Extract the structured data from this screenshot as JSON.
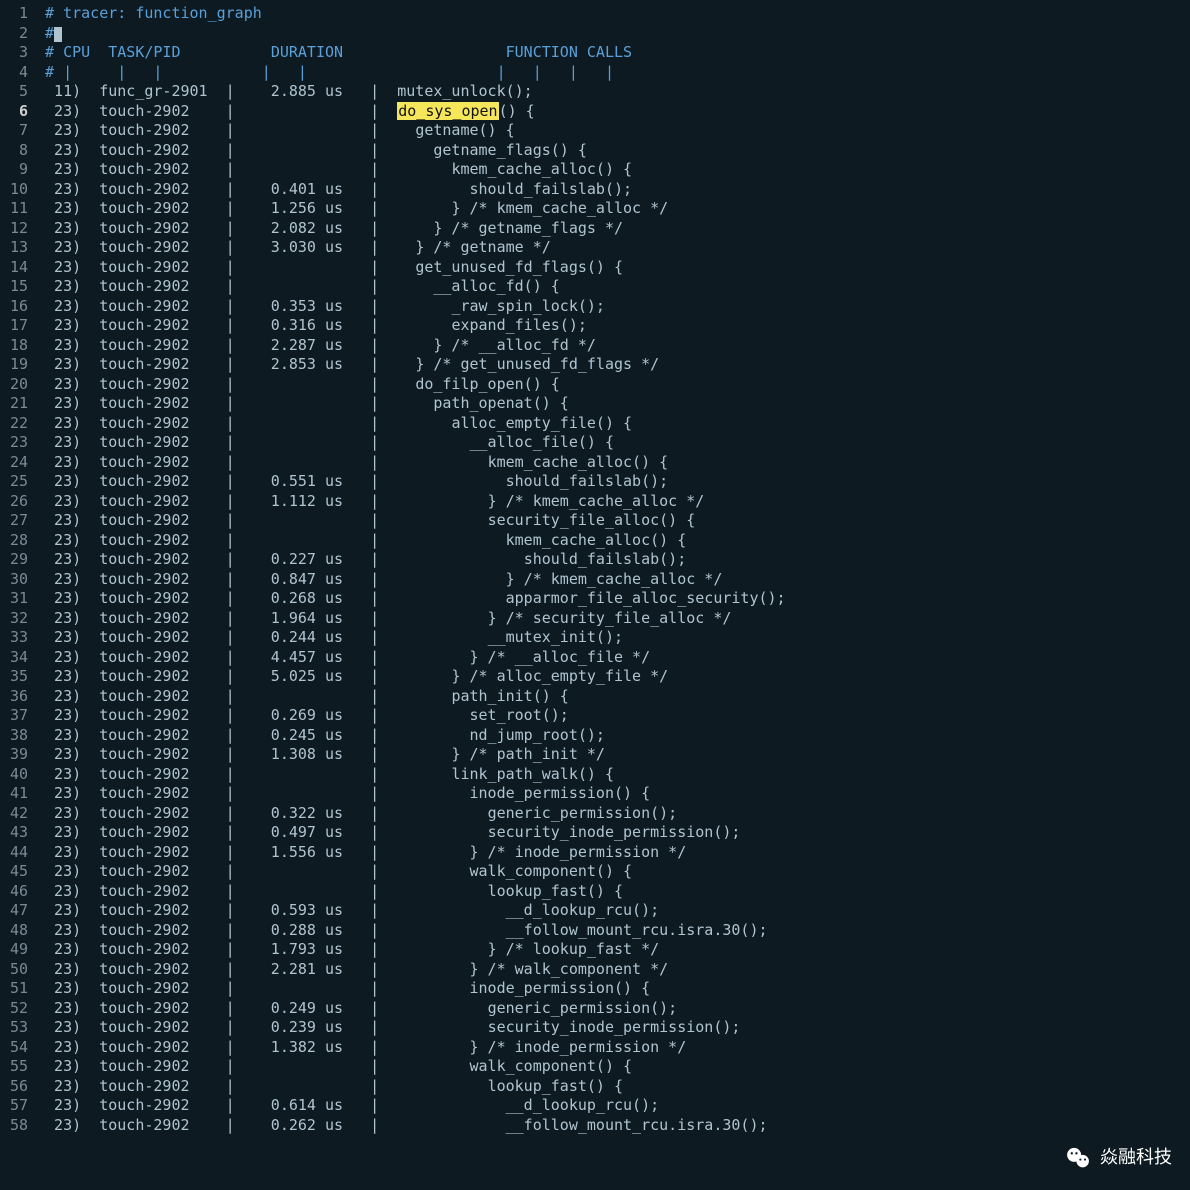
{
  "watermark": "焱融科技",
  "header": {
    "line1": "# tracer: function_graph",
    "cpu": "CPU",
    "task": "TASK/PID",
    "duration": "DURATION",
    "calls": "FUNCTION CALLS"
  },
  "rows": [
    {
      "n": 5,
      "cpu": "11)",
      "task": "func_gr-2901",
      "dur": "2.885 us",
      "indent": 0,
      "call": "mutex_unlock();"
    },
    {
      "n": 6,
      "cpu": "23)",
      "task": "touch-2902",
      "dur": "",
      "indent": 0,
      "call": "do_sys_open() {",
      "hl": true,
      "mark": "do_sys_open"
    },
    {
      "n": 7,
      "cpu": "23)",
      "task": "touch-2902",
      "dur": "",
      "indent": 1,
      "call": "getname() {"
    },
    {
      "n": 8,
      "cpu": "23)",
      "task": "touch-2902",
      "dur": "",
      "indent": 2,
      "call": "getname_flags() {"
    },
    {
      "n": 9,
      "cpu": "23)",
      "task": "touch-2902",
      "dur": "",
      "indent": 3,
      "call": "kmem_cache_alloc() {"
    },
    {
      "n": 10,
      "cpu": "23)",
      "task": "touch-2902",
      "dur": "0.401 us",
      "indent": 4,
      "call": "should_failslab();"
    },
    {
      "n": 11,
      "cpu": "23)",
      "task": "touch-2902",
      "dur": "1.256 us",
      "indent": 3,
      "call": "} /* kmem_cache_alloc */"
    },
    {
      "n": 12,
      "cpu": "23)",
      "task": "touch-2902",
      "dur": "2.082 us",
      "indent": 2,
      "call": "} /* getname_flags */"
    },
    {
      "n": 13,
      "cpu": "23)",
      "task": "touch-2902",
      "dur": "3.030 us",
      "indent": 1,
      "call": "} /* getname */"
    },
    {
      "n": 14,
      "cpu": "23)",
      "task": "touch-2902",
      "dur": "",
      "indent": 1,
      "call": "get_unused_fd_flags() {"
    },
    {
      "n": 15,
      "cpu": "23)",
      "task": "touch-2902",
      "dur": "",
      "indent": 2,
      "call": "__alloc_fd() {"
    },
    {
      "n": 16,
      "cpu": "23)",
      "task": "touch-2902",
      "dur": "0.353 us",
      "indent": 3,
      "call": "_raw_spin_lock();"
    },
    {
      "n": 17,
      "cpu": "23)",
      "task": "touch-2902",
      "dur": "0.316 us",
      "indent": 3,
      "call": "expand_files();"
    },
    {
      "n": 18,
      "cpu": "23)",
      "task": "touch-2902",
      "dur": "2.287 us",
      "indent": 2,
      "call": "} /* __alloc_fd */"
    },
    {
      "n": 19,
      "cpu": "23)",
      "task": "touch-2902",
      "dur": "2.853 us",
      "indent": 1,
      "call": "} /* get_unused_fd_flags */"
    },
    {
      "n": 20,
      "cpu": "23)",
      "task": "touch-2902",
      "dur": "",
      "indent": 1,
      "call": "do_filp_open() {"
    },
    {
      "n": 21,
      "cpu": "23)",
      "task": "touch-2902",
      "dur": "",
      "indent": 2,
      "call": "path_openat() {"
    },
    {
      "n": 22,
      "cpu": "23)",
      "task": "touch-2902",
      "dur": "",
      "indent": 3,
      "call": "alloc_empty_file() {"
    },
    {
      "n": 23,
      "cpu": "23)",
      "task": "touch-2902",
      "dur": "",
      "indent": 4,
      "call": "__alloc_file() {"
    },
    {
      "n": 24,
      "cpu": "23)",
      "task": "touch-2902",
      "dur": "",
      "indent": 5,
      "call": "kmem_cache_alloc() {"
    },
    {
      "n": 25,
      "cpu": "23)",
      "task": "touch-2902",
      "dur": "0.551 us",
      "indent": 6,
      "call": "should_failslab();"
    },
    {
      "n": 26,
      "cpu": "23)",
      "task": "touch-2902",
      "dur": "1.112 us",
      "indent": 5,
      "call": "} /* kmem_cache_alloc */"
    },
    {
      "n": 27,
      "cpu": "23)",
      "task": "touch-2902",
      "dur": "",
      "indent": 5,
      "call": "security_file_alloc() {"
    },
    {
      "n": 28,
      "cpu": "23)",
      "task": "touch-2902",
      "dur": "",
      "indent": 6,
      "call": "kmem_cache_alloc() {"
    },
    {
      "n": 29,
      "cpu": "23)",
      "task": "touch-2902",
      "dur": "0.227 us",
      "indent": 7,
      "call": "should_failslab();"
    },
    {
      "n": 30,
      "cpu": "23)",
      "task": "touch-2902",
      "dur": "0.847 us",
      "indent": 6,
      "call": "} /* kmem_cache_alloc */"
    },
    {
      "n": 31,
      "cpu": "23)",
      "task": "touch-2902",
      "dur": "0.268 us",
      "indent": 6,
      "call": "apparmor_file_alloc_security();"
    },
    {
      "n": 32,
      "cpu": "23)",
      "task": "touch-2902",
      "dur": "1.964 us",
      "indent": 5,
      "call": "} /* security_file_alloc */"
    },
    {
      "n": 33,
      "cpu": "23)",
      "task": "touch-2902",
      "dur": "0.244 us",
      "indent": 5,
      "call": "__mutex_init();"
    },
    {
      "n": 34,
      "cpu": "23)",
      "task": "touch-2902",
      "dur": "4.457 us",
      "indent": 4,
      "call": "} /* __alloc_file */"
    },
    {
      "n": 35,
      "cpu": "23)",
      "task": "touch-2902",
      "dur": "5.025 us",
      "indent": 3,
      "call": "} /* alloc_empty_file */"
    },
    {
      "n": 36,
      "cpu": "23)",
      "task": "touch-2902",
      "dur": "",
      "indent": 3,
      "call": "path_init() {"
    },
    {
      "n": 37,
      "cpu": "23)",
      "task": "touch-2902",
      "dur": "0.269 us",
      "indent": 4,
      "call": "set_root();"
    },
    {
      "n": 38,
      "cpu": "23)",
      "task": "touch-2902",
      "dur": "0.245 us",
      "indent": 4,
      "call": "nd_jump_root();"
    },
    {
      "n": 39,
      "cpu": "23)",
      "task": "touch-2902",
      "dur": "1.308 us",
      "indent": 3,
      "call": "} /* path_init */"
    },
    {
      "n": 40,
      "cpu": "23)",
      "task": "touch-2902",
      "dur": "",
      "indent": 3,
      "call": "link_path_walk() {"
    },
    {
      "n": 41,
      "cpu": "23)",
      "task": "touch-2902",
      "dur": "",
      "indent": 4,
      "call": "inode_permission() {"
    },
    {
      "n": 42,
      "cpu": "23)",
      "task": "touch-2902",
      "dur": "0.322 us",
      "indent": 5,
      "call": "generic_permission();"
    },
    {
      "n": 43,
      "cpu": "23)",
      "task": "touch-2902",
      "dur": "0.497 us",
      "indent": 5,
      "call": "security_inode_permission();"
    },
    {
      "n": 44,
      "cpu": "23)",
      "task": "touch-2902",
      "dur": "1.556 us",
      "indent": 4,
      "call": "} /* inode_permission */"
    },
    {
      "n": 45,
      "cpu": "23)",
      "task": "touch-2902",
      "dur": "",
      "indent": 4,
      "call": "walk_component() {"
    },
    {
      "n": 46,
      "cpu": "23)",
      "task": "touch-2902",
      "dur": "",
      "indent": 5,
      "call": "lookup_fast() {"
    },
    {
      "n": 47,
      "cpu": "23)",
      "task": "touch-2902",
      "dur": "0.593 us",
      "indent": 6,
      "call": "__d_lookup_rcu();"
    },
    {
      "n": 48,
      "cpu": "23)",
      "task": "touch-2902",
      "dur": "0.288 us",
      "indent": 6,
      "call": "__follow_mount_rcu.isra.30();"
    },
    {
      "n": 49,
      "cpu": "23)",
      "task": "touch-2902",
      "dur": "1.793 us",
      "indent": 5,
      "call": "} /* lookup_fast */"
    },
    {
      "n": 50,
      "cpu": "23)",
      "task": "touch-2902",
      "dur": "2.281 us",
      "indent": 4,
      "call": "} /* walk_component */"
    },
    {
      "n": 51,
      "cpu": "23)",
      "task": "touch-2902",
      "dur": "",
      "indent": 4,
      "call": "inode_permission() {"
    },
    {
      "n": 52,
      "cpu": "23)",
      "task": "touch-2902",
      "dur": "0.249 us",
      "indent": 5,
      "call": "generic_permission();"
    },
    {
      "n": 53,
      "cpu": "23)",
      "task": "touch-2902",
      "dur": "0.239 us",
      "indent": 5,
      "call": "security_inode_permission();"
    },
    {
      "n": 54,
      "cpu": "23)",
      "task": "touch-2902",
      "dur": "1.382 us",
      "indent": 4,
      "call": "} /* inode_permission */"
    },
    {
      "n": 55,
      "cpu": "23)",
      "task": "touch-2902",
      "dur": "",
      "indent": 4,
      "call": "walk_component() {"
    },
    {
      "n": 56,
      "cpu": "23)",
      "task": "touch-2902",
      "dur": "",
      "indent": 5,
      "call": "lookup_fast() {"
    },
    {
      "n": 57,
      "cpu": "23)",
      "task": "touch-2902",
      "dur": "0.614 us",
      "indent": 6,
      "call": "__d_lookup_rcu();"
    },
    {
      "n": 58,
      "cpu": "23)",
      "task": "touch-2902",
      "dur": "0.262 us",
      "indent": 6,
      "call": "__follow_mount_rcu.isra.30();"
    }
  ]
}
